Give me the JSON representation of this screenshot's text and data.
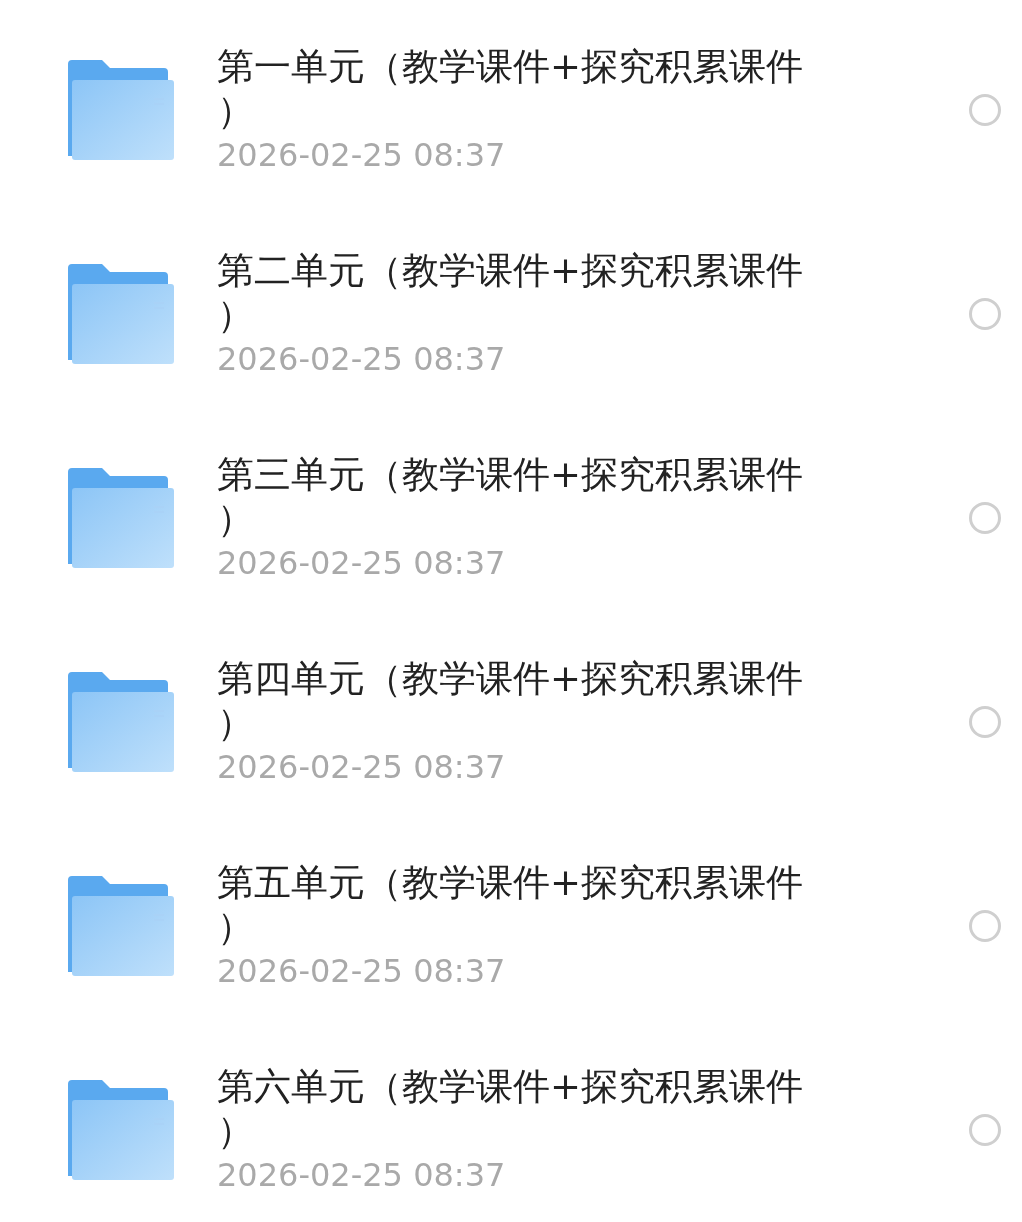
{
  "files": [
    {
      "title": "第一单元（教学课件+探究积累课件）",
      "date": "2026-02-25 08:37",
      "selected": false
    },
    {
      "title": "第二单元（教学课件+探究积累课件）",
      "date": "2026-02-25 08:37",
      "selected": false
    },
    {
      "title": "第三单元（教学课件+探究积累课件）",
      "date": "2026-02-25 08:37",
      "selected": false
    },
    {
      "title": "第四单元（教学课件+探究积累课件）",
      "date": "2026-02-25 08:37",
      "selected": false
    },
    {
      "title": "第五单元（教学课件+探究积累课件）",
      "date": "2026-02-25 08:37",
      "selected": false
    },
    {
      "title": "第六单元（教学课件+探究积累课件）",
      "date": "2026-02-25 08:37",
      "selected": false
    }
  ]
}
